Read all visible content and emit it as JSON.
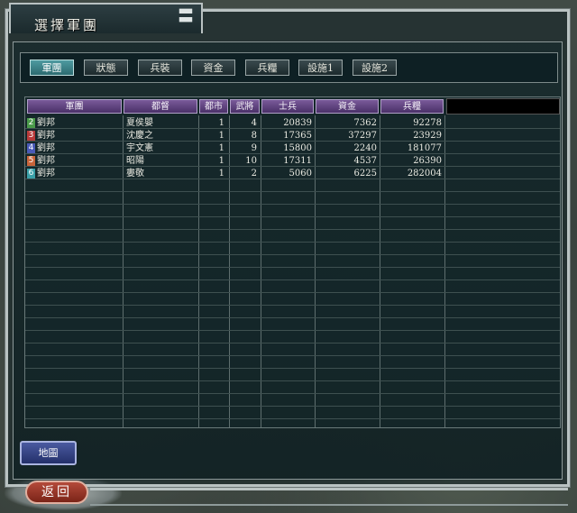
{
  "window": {
    "title": "選擇軍團"
  },
  "tabs": [
    {
      "label": "軍團",
      "active": true
    },
    {
      "label": "狀態",
      "active": false
    },
    {
      "label": "兵裝",
      "active": false
    },
    {
      "label": "資金",
      "active": false
    },
    {
      "label": "兵糧",
      "active": false
    },
    {
      "label": "設施1",
      "active": false
    },
    {
      "label": "設施2",
      "active": false
    }
  ],
  "table": {
    "headers": [
      "軍團",
      "都督",
      "都市",
      "武將",
      "士兵",
      "資金",
      "兵糧"
    ],
    "rows": [
      {
        "no": "2",
        "color": "#4a9a4a",
        "army": "劉邦",
        "commander": "夏侯嬰",
        "cities": "1",
        "generals": "4",
        "soldiers": "20839",
        "gold": "7362",
        "food": "92278"
      },
      {
        "no": "3",
        "color": "#b83a3a",
        "army": "劉邦",
        "commander": "沈慶之",
        "cities": "1",
        "generals": "8",
        "soldiers": "17365",
        "gold": "37297",
        "food": "23929"
      },
      {
        "no": "4",
        "color": "#4a5ab8",
        "army": "劉邦",
        "commander": "宇文憲",
        "cities": "1",
        "generals": "9",
        "soldiers": "15800",
        "gold": "2240",
        "food": "181077"
      },
      {
        "no": "5",
        "color": "#c8643a",
        "army": "劉邦",
        "commander": "昭陽",
        "cities": "1",
        "generals": "10",
        "soldiers": "17311",
        "gold": "4537",
        "food": "26390"
      },
      {
        "no": "6",
        "color": "#3aa0a8",
        "army": "劉邦",
        "commander": "婁敬",
        "cities": "1",
        "generals": "2",
        "soldiers": "5060",
        "gold": "6225",
        "food": "282004"
      }
    ]
  },
  "buttons": {
    "map": "地圖",
    "back": "返回"
  }
}
